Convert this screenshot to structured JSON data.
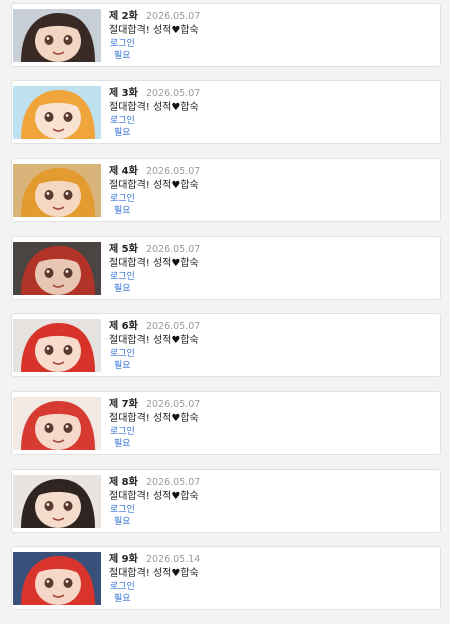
{
  "episodes": [
    {
      "ep": "제 2화",
      "date": "2026.05.07",
      "title_a": "절대합격! 성적",
      "heart": "♥",
      "title_b": "합숙",
      "login": "로그인",
      "required": "필요",
      "hair": "#3a2a25",
      "skin": "#f2d6c4",
      "bg": "#c9cfd6"
    },
    {
      "ep": "제 3화",
      "date": "2026.05.07",
      "title_a": "절대합격! 성적",
      "heart": "♥",
      "title_b": "합숙",
      "login": "로그인",
      "required": "필요",
      "hair": "#f0a53a",
      "skin": "#f8e3d3",
      "bg": "#bfe1ef"
    },
    {
      "ep": "제 4화",
      "date": "2026.05.07",
      "title_a": "절대합격! 성적",
      "heart": "♥",
      "title_b": "합숙",
      "login": "로그인",
      "required": "필요",
      "hair": "#e39a2e",
      "skin": "#f6d8c2",
      "bg": "#d8b47a"
    },
    {
      "ep": "제 5화",
      "date": "2026.05.07",
      "title_a": "절대합격! 성적",
      "heart": "♥",
      "title_b": "합숙",
      "login": "로그인",
      "required": "필요",
      "hair": "#b23328",
      "skin": "#e9c6b4",
      "bg": "#4a4543"
    },
    {
      "ep": "제 6화",
      "date": "2026.05.07",
      "title_a": "절대합격! 성적",
      "heart": "♥",
      "title_b": "합숙",
      "login": "로그인",
      "required": "필요",
      "hair": "#d8332a",
      "skin": "#f7dccd",
      "bg": "#e6e2df"
    },
    {
      "ep": "제 7화",
      "date": "2026.05.07",
      "title_a": "절대합격! 성적",
      "heart": "♥",
      "title_b": "합숙",
      "login": "로그인",
      "required": "필요",
      "hair": "#d63a30",
      "skin": "#f7d9cb",
      "bg": "#f0e9e4"
    },
    {
      "ep": "제 8화",
      "date": "2026.05.07",
      "title_a": "절대합격! 성적",
      "heart": "♥",
      "title_b": "합숙",
      "login": "로그인",
      "required": "필요",
      "hair": "#2e2523",
      "skin": "#f5dccd",
      "bg": "#e9e4e0"
    },
    {
      "ep": "제 9화",
      "date": "2026.05.14",
      "title_a": "절대합격! 성적",
      "heart": "♥",
      "title_b": "합숙",
      "login": "로그인",
      "required": "필요",
      "hair": "#d8342b",
      "skin": "#f6d6c6",
      "bg": "#38507a"
    }
  ]
}
